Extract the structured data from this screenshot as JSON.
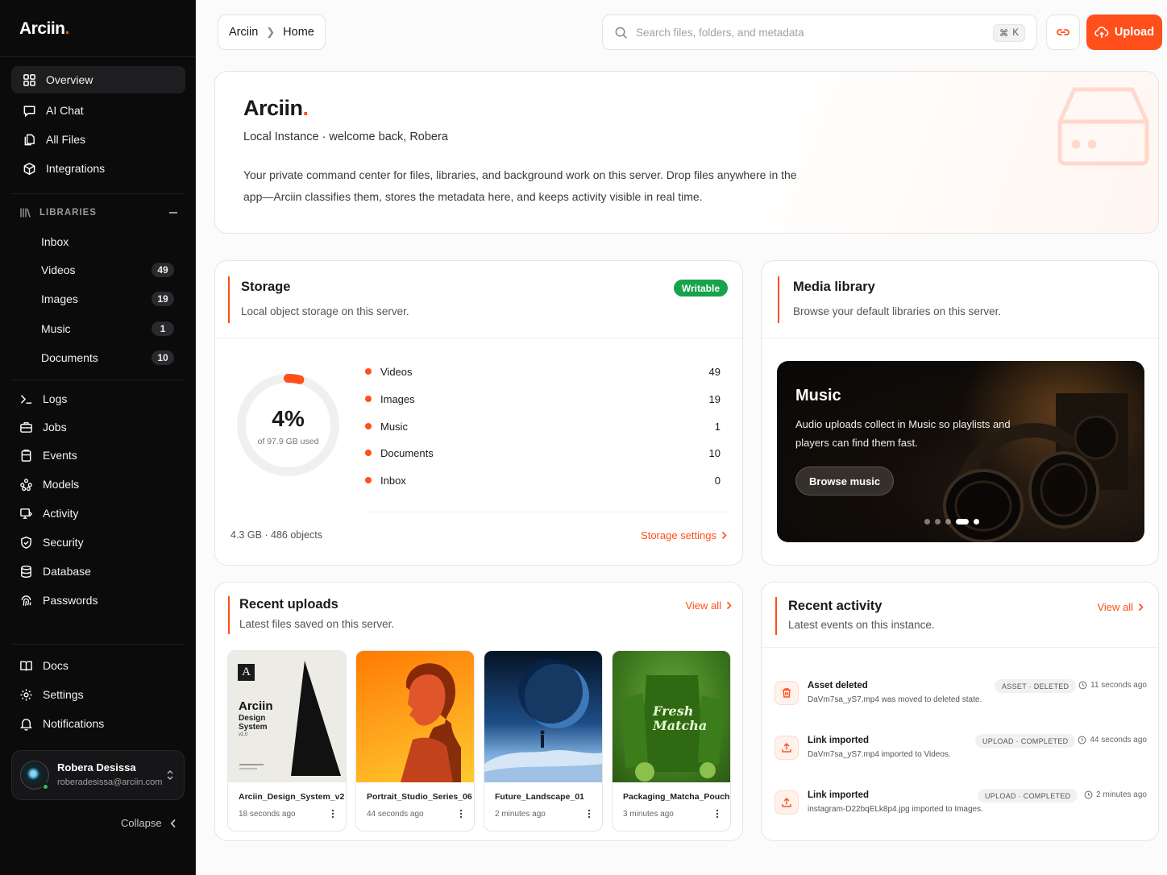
{
  "sidebar": {
    "brand": "Arciin",
    "brand_dot": ".",
    "nav": [
      {
        "label": "Overview",
        "icon": "grid-icon"
      },
      {
        "label": "AI Chat",
        "icon": "chat-icon"
      },
      {
        "label": "All Files",
        "icon": "files-icon"
      },
      {
        "label": "Integrations",
        "icon": "cube-icon"
      }
    ],
    "libraries_header": "LIBRARIES",
    "libraries": [
      {
        "label": "Inbox",
        "count": null
      },
      {
        "label": "Videos",
        "count": "49"
      },
      {
        "label": "Images",
        "count": "19"
      },
      {
        "label": "Music",
        "count": "1"
      },
      {
        "label": "Documents",
        "count": "10"
      }
    ],
    "tools": [
      {
        "label": "Logs",
        "icon": "terminal-icon"
      },
      {
        "label": "Jobs",
        "icon": "briefcase-icon"
      },
      {
        "label": "Events",
        "icon": "clipboard-icon"
      },
      {
        "label": "Models",
        "icon": "models-icon"
      },
      {
        "label": "Activity",
        "icon": "activity-icon"
      },
      {
        "label": "Security",
        "icon": "shield-icon"
      },
      {
        "label": "Database",
        "icon": "database-icon"
      },
      {
        "label": "Passwords",
        "icon": "fingerprint-icon"
      }
    ],
    "footer": [
      {
        "label": "Docs",
        "icon": "book-icon"
      },
      {
        "label": "Settings",
        "icon": "gear-icon"
      },
      {
        "label": "Notifications",
        "icon": "bell-icon"
      }
    ],
    "user": {
      "name": "Robera Desissa",
      "email": "roberadesissa@arciin.com"
    },
    "collapse_label": "Collapse"
  },
  "header": {
    "breadcrumb": [
      "Arciin",
      "Home"
    ],
    "search_placeholder": "Search files, folders, and metadata",
    "shortcut_symbol": "⌘",
    "shortcut_key": "K",
    "upload_label": "Upload"
  },
  "hero": {
    "title": "Arciin",
    "title_dot": ".",
    "subtitle": "Local Instance · welcome back, Robera",
    "description": "Your private command center for files, libraries, and background work on this server. Drop files anywhere in the app—Arciin classifies them, stores the metadata here, and keeps activity visible in real time."
  },
  "storage": {
    "title": "Storage",
    "subtitle": "Local object storage on this server.",
    "badge": "Writable",
    "percent_label": "4%",
    "percent_value": 4,
    "capacity_label": "of 97.9 GB used",
    "legend": [
      {
        "label": "Videos",
        "value": "49"
      },
      {
        "label": "Images",
        "value": "19"
      },
      {
        "label": "Music",
        "value": "1"
      },
      {
        "label": "Documents",
        "value": "10"
      },
      {
        "label": "Inbox",
        "value": "0"
      }
    ],
    "footer": "4.3 GB · 486 objects",
    "settings_link": "Storage settings",
    "accent": "#ff4f1a"
  },
  "media": {
    "title": "Media library",
    "subtitle": "Browse your default libraries on this server.",
    "slide_title": "Music",
    "slide_desc": "Audio uploads collect in Music so playlists and players can find them fast.",
    "slide_button": "Browse music",
    "slide_active": 4,
    "slide_count": 5
  },
  "uploads": {
    "title": "Recent uploads",
    "subtitle": "Latest files saved on this server.",
    "view_all": "View all",
    "items": [
      {
        "name": "Arciin_Design_System_v2",
        "time": "18 seconds ago",
        "thumb_brand": "Arciin",
        "thumb_lines": [
          "Design",
          "System",
          "v2.0"
        ],
        "thumb_letter": "A"
      },
      {
        "name": "Portrait_Studio_Series_06",
        "time": "44 seconds ago"
      },
      {
        "name": "Future_Landscape_01",
        "time": "2 minutes ago"
      },
      {
        "name": "Packaging_Matcha_Pouch",
        "time": "3 minutes ago",
        "thumb_text": [
          "Fresh",
          "Matcha"
        ]
      }
    ]
  },
  "activity": {
    "title": "Recent activity",
    "subtitle": "Latest events on this instance.",
    "view_all": "View all",
    "items": [
      {
        "title": "Asset deleted",
        "desc": "DaVm7sa_yS7.mp4 was moved to deleted state.",
        "tag": "ASSET · DELETED",
        "time": "11 seconds ago",
        "icon": "trash-icon"
      },
      {
        "title": "Link imported",
        "desc": "DaVm7sa_yS7.mp4 imported to Videos.",
        "tag": "UPLOAD · COMPLETED",
        "time": "44 seconds ago",
        "icon": "upload-icon"
      },
      {
        "title": "Link imported",
        "desc": "instagram-D22bqELk8p4.jpg imported to Images.",
        "tag": "UPLOAD · COMPLETED",
        "time": "2 minutes ago",
        "icon": "upload-icon"
      }
    ]
  }
}
